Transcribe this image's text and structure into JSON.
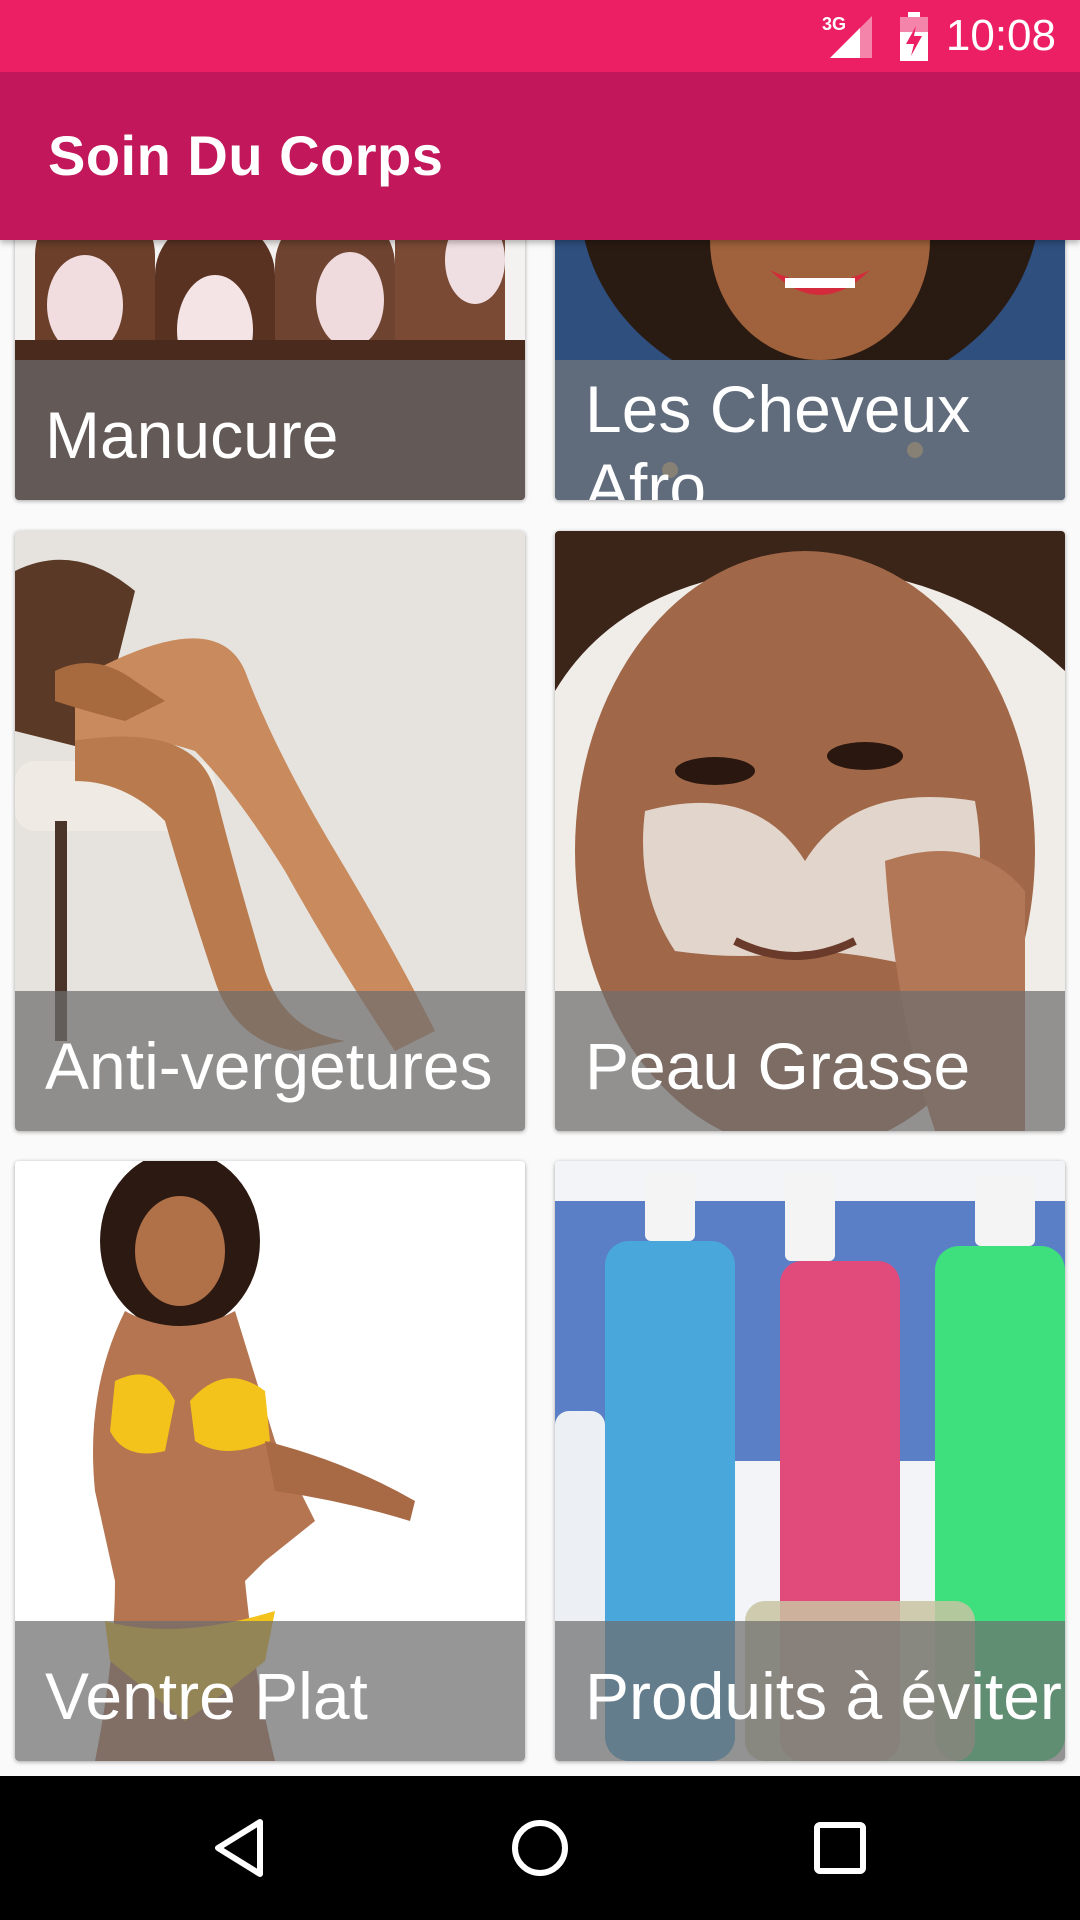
{
  "status_bar": {
    "network": "3G",
    "time": "10:08",
    "color": "#ec1f64"
  },
  "app_bar": {
    "title": "Soin Du Corps",
    "color": "#c2185b"
  },
  "cards": [
    {
      "label": "Manucure"
    },
    {
      "label": "Les Cheveux Afro"
    },
    {
      "label": "Anti-vergetures"
    },
    {
      "label": "Peau Grasse"
    },
    {
      "label": "Ventre Plat"
    },
    {
      "label": "Produits à éviter"
    }
  ],
  "nav_bar": {
    "icons": [
      "back-icon",
      "home-icon",
      "recents-icon"
    ]
  }
}
